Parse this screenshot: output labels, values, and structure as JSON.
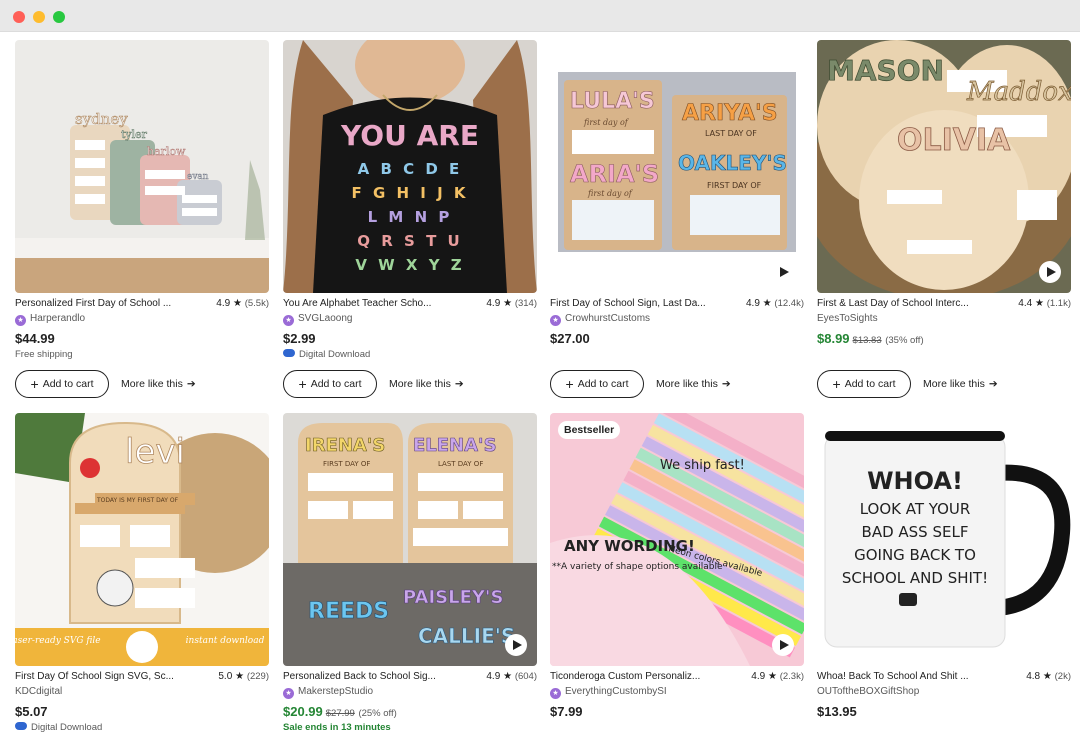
{
  "window": {
    "controls": [
      "close",
      "minimize",
      "maximize"
    ]
  },
  "listings": [
    {
      "title": "Personalized First Day of School ...",
      "rating": "4.9",
      "reviews": "(5.5k)",
      "shop": "Harperandlo",
      "star_seller": true,
      "price": "$44.99",
      "original_price": "",
      "discount": "",
      "note": "Free shipping",
      "note_type": "plain",
      "cart_label": "Add to cart",
      "more_label": "More like this",
      "has_video": false,
      "badge": "",
      "image_desc": "sydney-sign"
    },
    {
      "title": "You Are Alphabet Teacher Scho...",
      "rating": "4.9",
      "reviews": "(314)",
      "shop": "SVGLaoong",
      "star_seller": true,
      "price": "$2.99",
      "original_price": "",
      "discount": "",
      "note": "Digital Download",
      "note_type": "digital",
      "cart_label": "Add to cart",
      "more_label": "More like this",
      "has_video": false,
      "badge": "",
      "image_desc": "you-are-shirt"
    },
    {
      "title": "First Day of School Sign, Last Da...",
      "rating": "4.9",
      "reviews": "(12.4k)",
      "shop": "CrowhurstCustoms",
      "star_seller": true,
      "price": "$27.00",
      "original_price": "",
      "discount": "",
      "note": "",
      "note_type": "plain",
      "cart_label": "Add to cart",
      "more_label": "More like this",
      "has_video": true,
      "badge": "",
      "image_desc": "lula-aria-signs"
    },
    {
      "title": "First & Last Day of School Interc...",
      "rating": "4.4",
      "reviews": "(1.1k)",
      "shop": "EyesToSights",
      "star_seller": false,
      "price": "$8.99",
      "original_price": "$13.83",
      "discount": "(35% off)",
      "note": "",
      "note_type": "plain",
      "cart_label": "Add to cart",
      "more_label": "More like this",
      "has_video": true,
      "badge": "",
      "image_desc": "mason-olivia-signs"
    },
    {
      "title": "First Day Of School Sign SVG, Sc...",
      "rating": "5.0",
      "reviews": "(229)",
      "shop": "KDCdigital",
      "star_seller": false,
      "price": "$5.07",
      "original_price": "",
      "discount": "",
      "note": "Digital Download",
      "note_type": "digital",
      "cart_label": "",
      "more_label": "",
      "has_video": false,
      "badge": "",
      "image_desc": "levi-svg"
    },
    {
      "title": "Personalized Back to School Sig...",
      "rating": "4.9",
      "reviews": "(604)",
      "shop": "MakerstepStudio",
      "star_seller": true,
      "price": "$20.99",
      "original_price": "$27.99",
      "discount": "(25% off)",
      "note": "Sale ends in 13 minutes",
      "note_type": "sale",
      "cart_label": "",
      "more_label": "",
      "has_video": true,
      "badge": "",
      "image_desc": "irena-elena-signs"
    },
    {
      "title": "Ticonderoga Custom Personaliz...",
      "rating": "4.9",
      "reviews": "(2.3k)",
      "shop": "EverythingCustombySI",
      "star_seller": true,
      "price": "$7.99",
      "original_price": "",
      "discount": "",
      "note": "",
      "note_type": "plain",
      "cart_label": "",
      "more_label": "",
      "has_video": true,
      "badge": "Bestseller",
      "image_desc": "pencils"
    },
    {
      "title": "Whoa! Back To School And Shit ...",
      "rating": "4.8",
      "reviews": "(2k)",
      "shop": "OUToftheBOXGiftShop",
      "star_seller": false,
      "price": "$13.95",
      "original_price": "",
      "discount": "",
      "note": "",
      "note_type": "plain",
      "cart_label": "",
      "more_label": "",
      "has_video": false,
      "badge": "",
      "image_desc": "whoa-mug"
    }
  ],
  "image_text": {
    "sydney": [
      "sydney",
      "tyler",
      "harlow",
      "evan"
    ],
    "shirt": [
      "YOU ARE",
      "A B C D E",
      "F G H I J K",
      "L M N P",
      "Q R S T U",
      "V W X Y Z"
    ],
    "lula": [
      "LULA'S",
      "first day of",
      "ARIA'S",
      "first day of",
      "ARIYA'S",
      "LAST DAY OF",
      "OAKLEY'S",
      "FIRST DAY OF"
    ],
    "mason": [
      "MASON",
      "Maddox",
      "OLIVIA"
    ],
    "levi": [
      "levi",
      "TODAY IS MY FIRST DAY OF",
      "laser-ready SVG file",
      "instant download"
    ],
    "irena": [
      "IRENA'S",
      "FIRST DAY OF",
      "ELENA'S",
      "LAST DAY OF",
      "PAISLEY'S",
      "REEDS",
      "CALLIE'S"
    ],
    "pencils": [
      "We ship fast!",
      "ANY WORDING!",
      "**A variety of shape options available",
      "Neon colors available"
    ],
    "mug": [
      "WHOA!",
      "LOOK AT YOUR",
      "BAD ASS SELF",
      "GOING BACK TO",
      "SCHOOL AND SHIT!"
    ]
  },
  "colors": {
    "sale_green": "#258635",
    "star_seller_purple": "#9a6bd6",
    "digital_blue": "#2f66d0"
  }
}
